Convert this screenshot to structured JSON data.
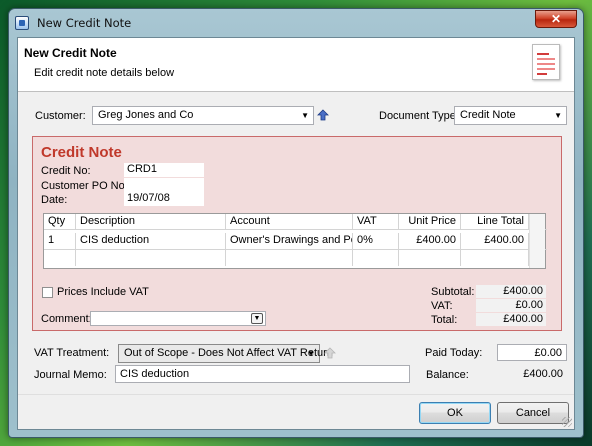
{
  "window": {
    "title": "New Credit Note",
    "close_glyph": "✕"
  },
  "header": {
    "title": "New Credit Note",
    "subtitle": "Edit credit note details below",
    "icon": "credit-note-document-icon"
  },
  "customer": {
    "label": "Customer:",
    "value": "Greg Jones and Co"
  },
  "document_type": {
    "label": "Document Type:",
    "value": "Credit Note"
  },
  "credit_note": {
    "heading": "Credit Note",
    "credit_no_label": "Credit No:",
    "credit_no": "CRD1",
    "po_label": "Customer PO No:",
    "po": "",
    "date_label": "Date:",
    "date": "19/07/08"
  },
  "lines": {
    "columns": [
      "Qty",
      "Description",
      "Account",
      "VAT",
      "Unit Price",
      "Line Total"
    ],
    "rows": [
      [
        "1",
        "CIS deduction",
        "Owner's Drawings and Person",
        "0%",
        "£400.00",
        "£400.00"
      ]
    ]
  },
  "prices_include_vat": {
    "label": "Prices Include VAT",
    "checked": false
  },
  "comment": {
    "label": "Comment:",
    "value": ""
  },
  "totals": {
    "subtotal_label": "Subtotal:",
    "subtotal": "£400.00",
    "vat_label": "VAT:",
    "vat": "£0.00",
    "total_label": "Total:",
    "total": "£400.00"
  },
  "vat_treatment": {
    "label": "VAT Treatment:",
    "value": "Out of Scope - Does Not Affect VAT Return"
  },
  "journal_memo": {
    "label": "Journal Memo:",
    "value": "CIS deduction"
  },
  "paid_today": {
    "label": "Paid Today:",
    "value": "£0.00"
  },
  "balance": {
    "label": "Balance:",
    "value": "£400.00"
  },
  "buttons": {
    "ok": "OK",
    "cancel": "Cancel"
  },
  "colors": {
    "panel_bg": "#f2dcdc",
    "panel_border": "#c96a6a",
    "heading": "#c0392b"
  }
}
